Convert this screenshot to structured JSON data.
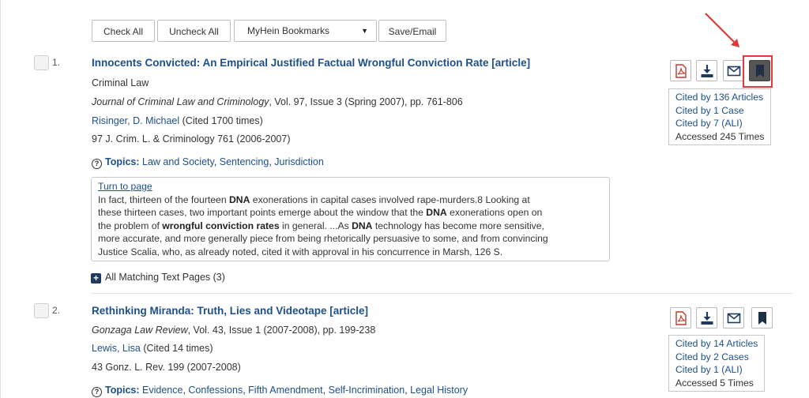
{
  "toolbar": {
    "check_all": "Check All",
    "uncheck_all": "Uncheck All",
    "bookmarks_select": "MyHein Bookmarks",
    "save_email": "Save/Email"
  },
  "results": [
    {
      "number": "1.",
      "title": "Innocents Convicted: An Empirical Justified Factual Wrongful Conviction Rate [article]",
      "subject": "Criminal Law",
      "journal": "Journal of Criminal Law and Criminology",
      "journal_rest": ", Vol. 97, Issue 3 (Spring 2007), pp. 761-806",
      "author": "Risinger, D. Michael",
      "author_cited": " (Cited 1700 times)",
      "citation": "97 J. Crim. L. & Criminology 761 (2006-2007)",
      "topics_label": "Topics:",
      "topics": [
        "Law and Society",
        "Sentencing",
        "Jurisdiction"
      ],
      "turn_to_page": "Turn to page",
      "snippet_lines": [
        [
          "In fact, thirteen of the fourteen ",
          "DNA",
          " exonerations in capital cases involved rape-murders.8 Looking at"
        ],
        [
          "these thirteen cases, two important points emerge about the window that the ",
          "DNA",
          " exonerations open on"
        ],
        [
          "the problem of ",
          "wrongful conviction rates",
          " in general. ...As ",
          "DNA",
          " technology has become more sensitive,"
        ],
        [
          "more accurate, and more generally piece from being rhetorically persuasive to some, and from convincing"
        ],
        [
          "Justice Scalia, who, as already noted, cited it with approval in his concurrence in Marsh, 126 S."
        ]
      ],
      "more_pages": "All Matching Text Pages (3)",
      "stats": {
        "cited_articles": "Cited by 136 Articles",
        "cited_cases": "Cited by 1 Case",
        "cited_ali": "Cited by 7 (ALI)",
        "accessed": "Accessed 245 Times"
      }
    },
    {
      "number": "2.",
      "title": "Rethinking Miranda: Truth, Lies and Videotape [article]",
      "journal": "Gonzaga Law Review",
      "journal_rest": ", Vol. 43, Issue 1 (2007-2008), pp. 199-238",
      "author": "Lewis, Lisa",
      "author_cited": " (Cited 14 times)",
      "citation": "43 Gonz. L. Rev. 199 (2007-2008)",
      "topics_label": "Topics:",
      "topics": [
        "Evidence",
        "Confessions",
        "Fifth Amendment",
        "Self-Incrimination",
        "Legal History"
      ],
      "stats": {
        "cited_articles": "Cited by 14 Articles",
        "cited_cases": "Cited by 2 Cases",
        "cited_ali": "Cited by 1 (ALI)",
        "accessed": "Accessed 5 Times"
      }
    }
  ],
  "icons": {
    "pdf": "pdf-icon",
    "download": "download-icon",
    "email": "email-icon",
    "bookmark": "bookmark-icon",
    "annotation_arrow": "arrow-icon"
  },
  "colors": {
    "link": "#1d4f8a",
    "highlight": "#e03a3a",
    "pdf_red": "#c0392b",
    "icon_navy": "#1e3a5c"
  }
}
